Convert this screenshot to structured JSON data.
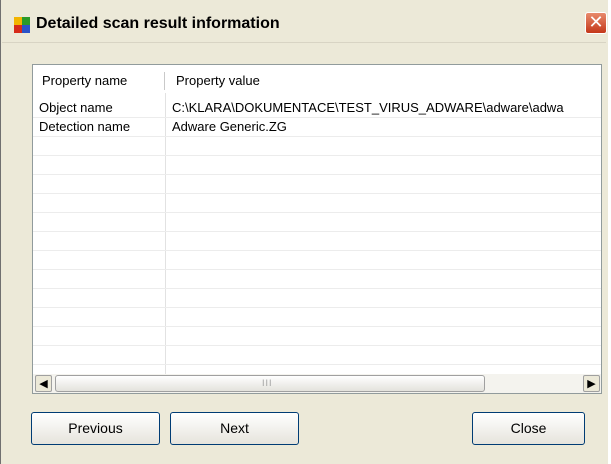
{
  "window": {
    "title": "Detailed scan result information",
    "close_glyph": "✕"
  },
  "table": {
    "columns": [
      "Property name",
      "Property value"
    ],
    "rows": [
      {
        "name": "Object name",
        "value": "C:\\KLARA\\DOKUMENTACE\\TEST_VIRUS_ADWARE\\adware\\adwa"
      },
      {
        "name": "Detection name",
        "value": "Adware Generic.ZG"
      }
    ],
    "scroll_left_glyph": "◀",
    "scroll_right_glyph": "▶",
    "thumb_grip": "III"
  },
  "buttons": {
    "previous": "Previous",
    "next": "Next",
    "close": "Close"
  },
  "colors": {
    "dialog_background": "#ece9d8",
    "close_button": "#c4381a",
    "icon_colors": [
      "#f2b400",
      "#2a9a2a",
      "#d62a1a",
      "#2a52c8"
    ]
  }
}
